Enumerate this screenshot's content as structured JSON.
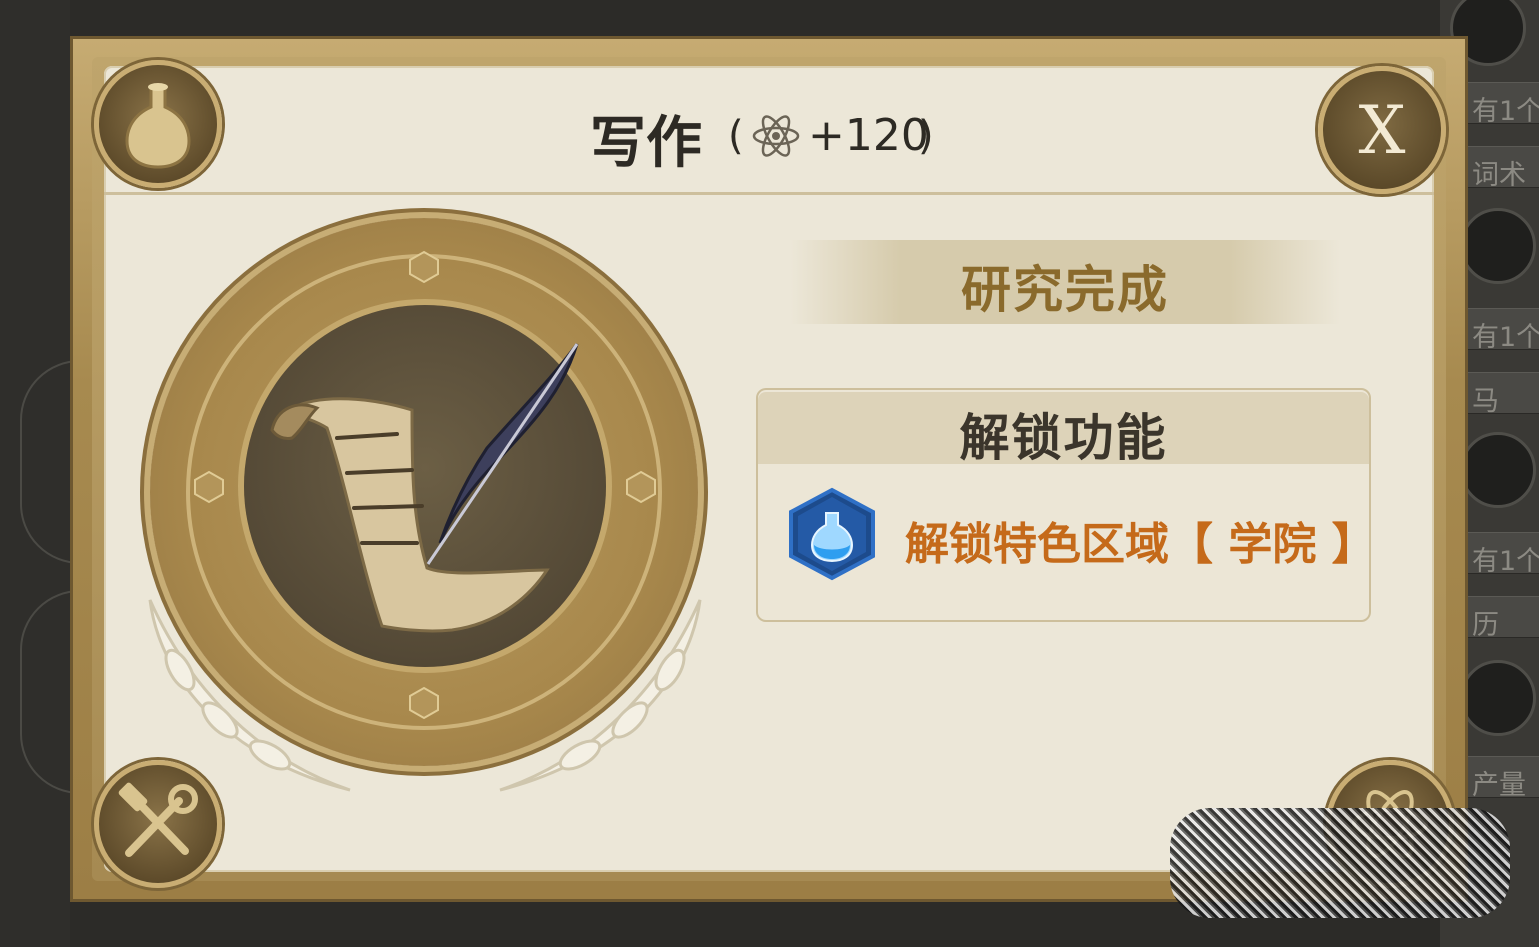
{
  "dialog": {
    "title": "写作",
    "bonus_open": "(",
    "bonus_value": "+120",
    "bonus_close": ")",
    "bonus_icon": "atom-icon",
    "close_label": "X",
    "status": "研究完成",
    "unlock_section": {
      "title": "解锁功能",
      "items": [
        {
          "icon": "flask-icon",
          "label": "解锁特色区域【 学院 】"
        }
      ]
    },
    "corner_icons": [
      "flask-icon",
      "hammer-wrench-icon",
      "atom-icon"
    ],
    "medal_icon": "scroll-quill-icon"
  },
  "background": {
    "right_rows": [
      "有1个",
      "词术",
      "有1个",
      "马",
      "有1个",
      "历",
      "产量"
    ]
  },
  "colors": {
    "panel_bg": "#ece7d8",
    "frame_gold": "#c6ab72",
    "status_text": "#8a6a2c",
    "unlock_item_text": "#c56a1a",
    "title_text": "#2d2a24"
  }
}
